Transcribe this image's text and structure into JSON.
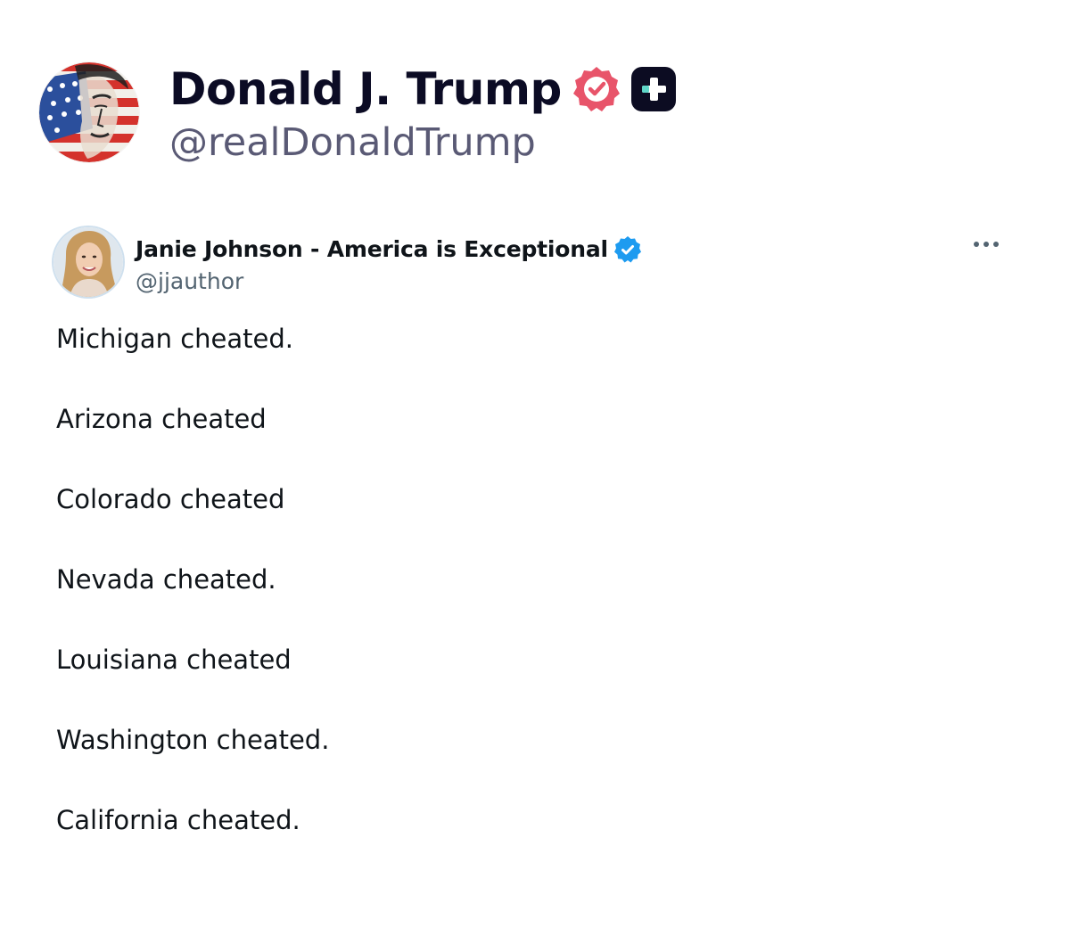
{
  "post": {
    "author": {
      "display_name": "Donald J. Trump",
      "handle": "@realDonaldTrump",
      "avatar_icon": "portrait-flag-avatar",
      "verified_icon": "verified-badge-icon",
      "verified_color": "#e8546a",
      "app_badge_icon": "truth-social-icon"
    }
  },
  "embedded_tweet": {
    "author": {
      "display_name": "Janie Johnson - America is Exceptional",
      "handle": "@jjauthor",
      "avatar_icon": "profile-photo-avatar",
      "verified_icon": "verified-badge-icon",
      "verified_color": "#1d9bf0"
    },
    "more_icon": "more-dots-icon",
    "lines": [
      "Michigan cheated.",
      "Arizona cheated",
      "Colorado cheated",
      "Nevada cheated.",
      "Louisiana cheated",
      "Washington cheated.",
      "California cheated."
    ]
  }
}
